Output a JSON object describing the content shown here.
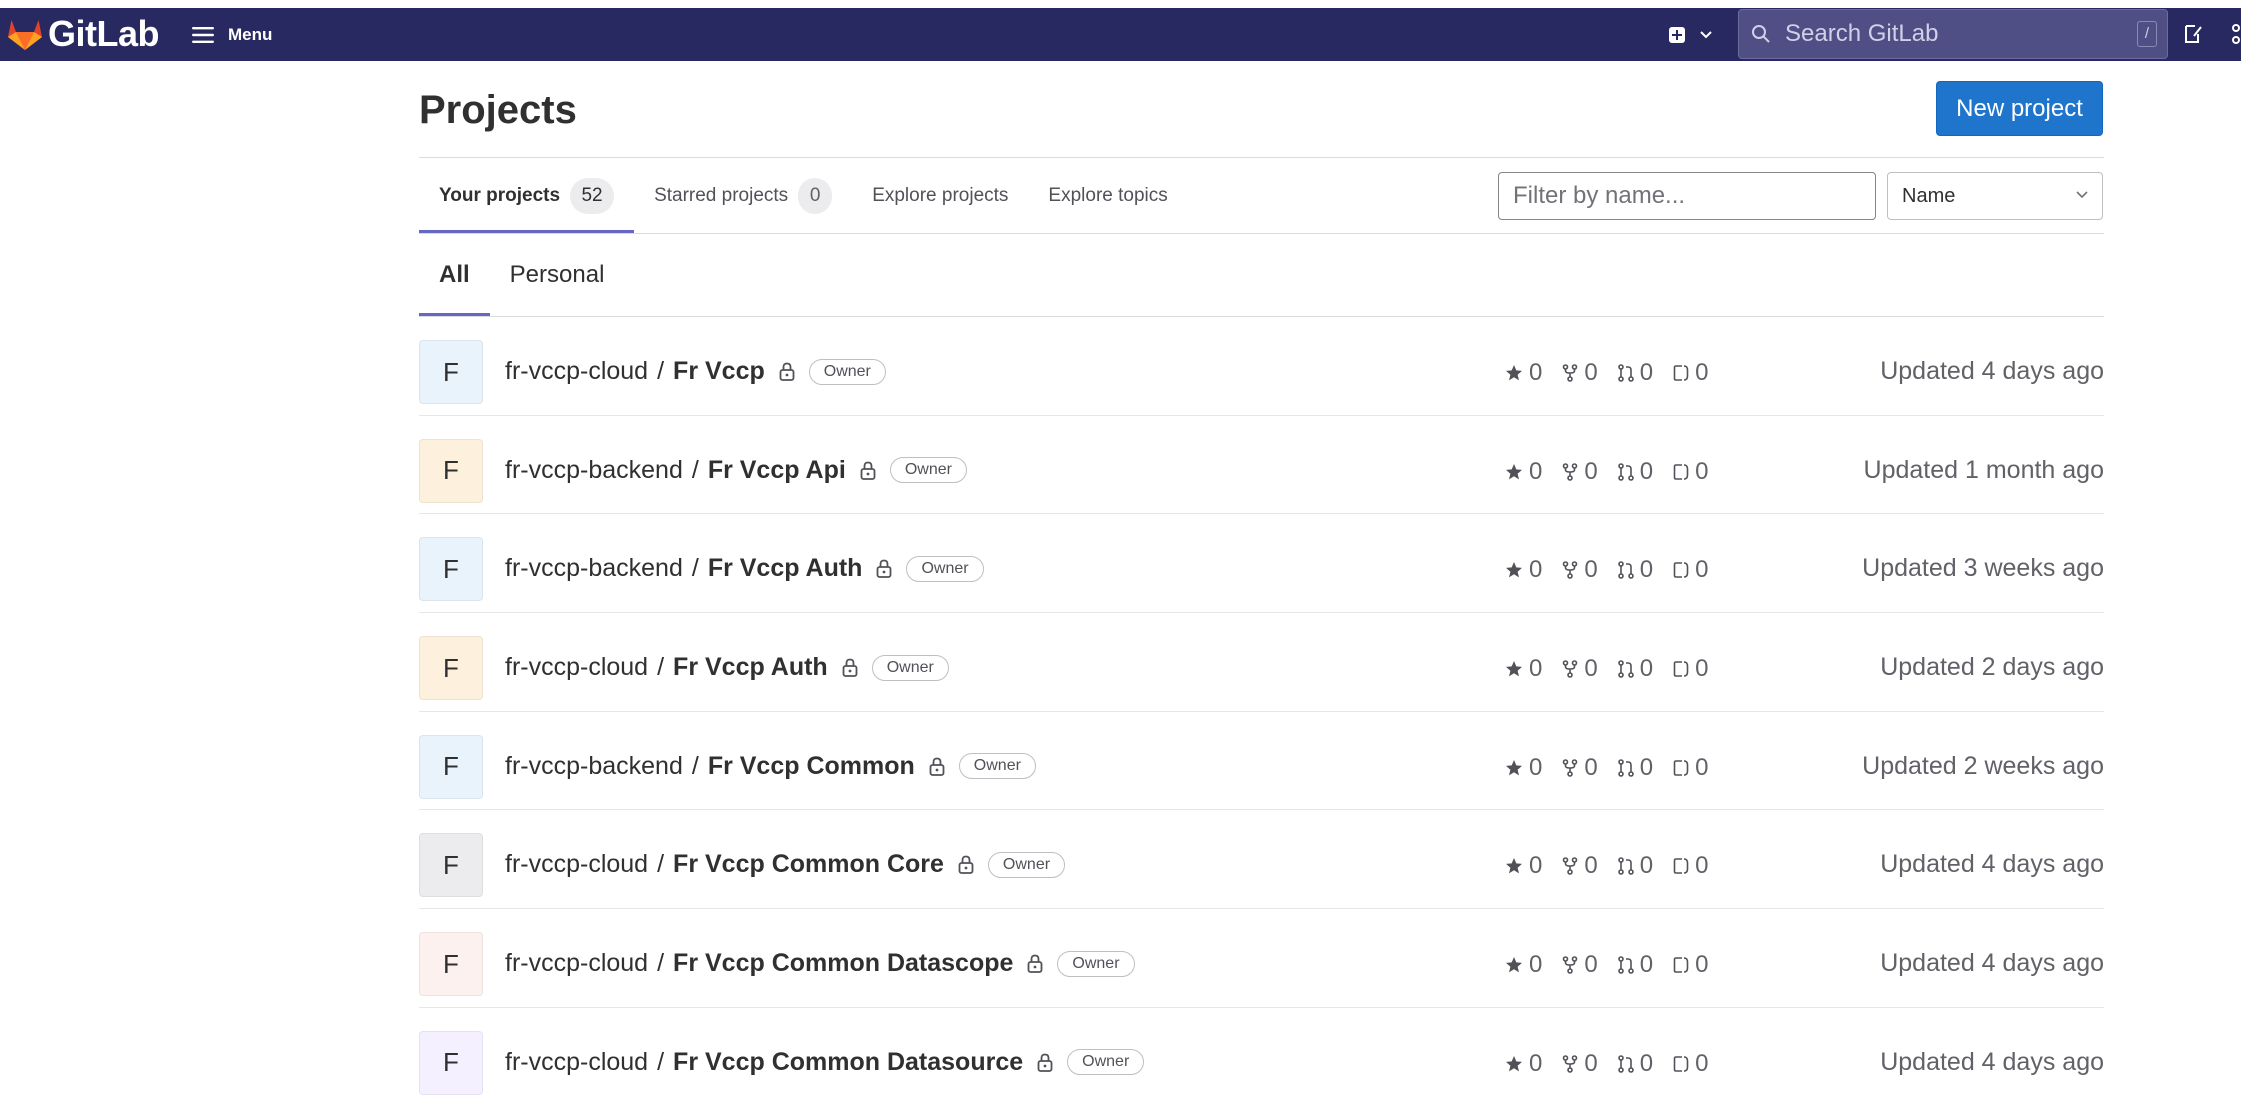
{
  "header": {
    "brand": "GitLab",
    "menu_label": "Menu",
    "search_placeholder": "Search GitLab",
    "search_shortcut": "/"
  },
  "page": {
    "title": "Projects",
    "new_project_label": "New project"
  },
  "tabs": [
    {
      "label": "Your projects",
      "count": "52",
      "active": true
    },
    {
      "label": "Starred projects",
      "count": "0",
      "active": false
    },
    {
      "label": "Explore projects",
      "active": false
    },
    {
      "label": "Explore topics",
      "active": false
    }
  ],
  "filter": {
    "placeholder": "Filter by name...",
    "sort_selected": "Name"
  },
  "subtabs": [
    {
      "label": "All",
      "active": true
    },
    {
      "label": "Personal",
      "active": false
    }
  ],
  "projects": [
    {
      "avatar_letter": "F",
      "avatar_color": "#e9f3fc",
      "namespace": "fr-vccp-cloud",
      "name": "Fr Vccp",
      "role": "Owner",
      "stars": "0",
      "forks": "0",
      "merge_requests": "0",
      "issues": "0",
      "updated": "Updated 4 days ago"
    },
    {
      "avatar_letter": "F",
      "avatar_color": "#fdf1dd",
      "namespace": "fr-vccp-backend",
      "name": "Fr Vccp Api",
      "role": "Owner",
      "stars": "0",
      "forks": "0",
      "merge_requests": "0",
      "issues": "0",
      "updated": "Updated 1 month ago"
    },
    {
      "avatar_letter": "F",
      "avatar_color": "#e9f3fc",
      "namespace": "fr-vccp-backend",
      "name": "Fr Vccp Auth",
      "role": "Owner",
      "stars": "0",
      "forks": "0",
      "merge_requests": "0",
      "issues": "0",
      "updated": "Updated 3 weeks ago"
    },
    {
      "avatar_letter": "F",
      "avatar_color": "#fdf1dd",
      "namespace": "fr-vccp-cloud",
      "name": "Fr Vccp Auth",
      "role": "Owner",
      "stars": "0",
      "forks": "0",
      "merge_requests": "0",
      "issues": "0",
      "updated": "Updated 2 days ago"
    },
    {
      "avatar_letter": "F",
      "avatar_color": "#e9f3fc",
      "namespace": "fr-vccp-backend",
      "name": "Fr Vccp Common",
      "role": "Owner",
      "stars": "0",
      "forks": "0",
      "merge_requests": "0",
      "issues": "0",
      "updated": "Updated 2 weeks ago"
    },
    {
      "avatar_letter": "F",
      "avatar_color": "#ececef",
      "namespace": "fr-vccp-cloud",
      "name": "Fr Vccp Common Core",
      "role": "Owner",
      "stars": "0",
      "forks": "0",
      "merge_requests": "0",
      "issues": "0",
      "updated": "Updated 4 days ago"
    },
    {
      "avatar_letter": "F",
      "avatar_color": "#fcf1ef",
      "namespace": "fr-vccp-cloud",
      "name": "Fr Vccp Common Datascope",
      "role": "Owner",
      "stars": "0",
      "forks": "0",
      "merge_requests": "0",
      "issues": "0",
      "updated": "Updated 4 days ago"
    },
    {
      "avatar_letter": "F",
      "avatar_color": "#f4f0ff",
      "namespace": "fr-vccp-cloud",
      "name": "Fr Vccp Common Datasource",
      "role": "Owner",
      "stars": "0",
      "forks": "0",
      "merge_requests": "0",
      "issues": "0",
      "updated": "Updated 4 days ago"
    }
  ],
  "icons": {
    "star": "star-icon",
    "fork": "fork-icon",
    "merge_request": "merge-request-icon",
    "issue": "issue-icon",
    "lock": "lock-icon"
  },
  "colors": {
    "navbar": "#292961",
    "primary_button": "#1f75cb",
    "active_tab": "#6666c4"
  }
}
